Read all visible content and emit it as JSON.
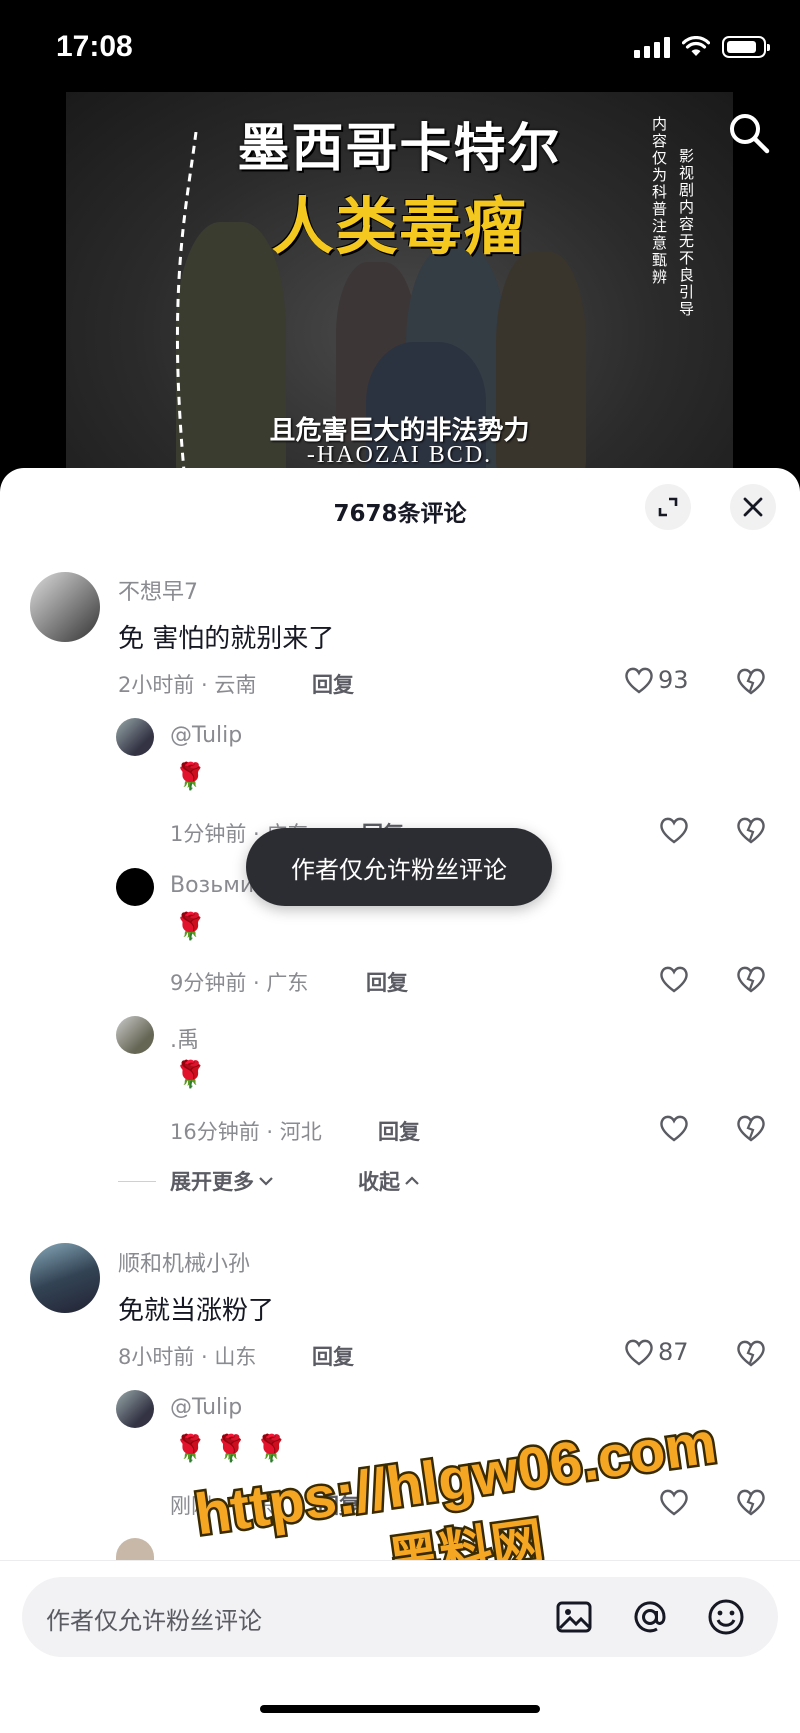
{
  "status_bar": {
    "time": "17:08",
    "battery_level": 0.85
  },
  "video": {
    "title_line1": "墨西哥卡特尔",
    "title_line2": "人类毒瘤",
    "caption": "且危害巨大的非法势力",
    "brand": "-HAOZAI BCD.",
    "side_text_1": "影视剧内容无不良引导",
    "side_text_2": "内容仅为科普注意甄辨"
  },
  "sheet": {
    "title": "7678条评论"
  },
  "comments": [
    {
      "username": "不想早7",
      "text": "免 害怕的就别来了",
      "meta": "2小时前 · 云南",
      "reply_label": "回复",
      "likes": "93",
      "replies": [
        {
          "username": "@Tulip",
          "text": "🌹",
          "meta": "1分钟前 · 广东",
          "reply_label": "回复"
        },
        {
          "username": "Возьми",
          "text": "🌹",
          "meta": "9分钟前 · 广东",
          "reply_label": "回复"
        },
        {
          "username": ".禹",
          "text": "🌹",
          "meta": "16分钟前 · 河北",
          "reply_label": "回复"
        }
      ],
      "expand_label": "展开更多",
      "collapse_label": "收起"
    },
    {
      "username": "顺和机械小孙",
      "text": "免就当涨粉了",
      "meta": "8小时前 · 山东",
      "reply_label": "回复",
      "likes": "87",
      "replies": [
        {
          "username": "@Tulip",
          "text": "🌹 🌹 🌹",
          "meta": "刚刚 · 广东",
          "reply_label": "回复"
        }
      ]
    }
  ],
  "toast": "作者仅允许粉丝评论",
  "watermark": {
    "line1": "https://hlgw06.com",
    "line2": "黑料网"
  },
  "input": {
    "placeholder": "作者仅允许粉丝评论"
  },
  "colors": {
    "accent_watermark": "#f5a623",
    "toast_bg": "#2c2d33",
    "sheet_bg": "#ffffff"
  }
}
